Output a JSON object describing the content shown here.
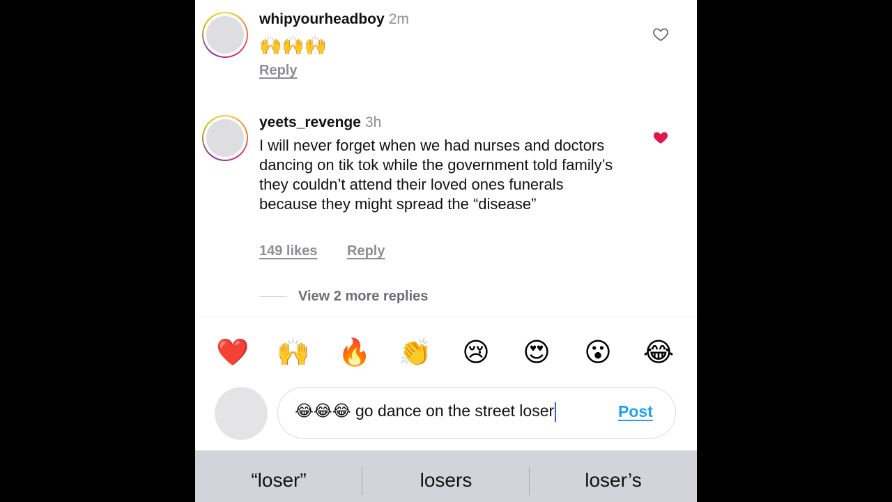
{
  "comments": [
    {
      "username": "whipyourheadboy",
      "time": "2m",
      "text": "🙌🙌🙌",
      "reply_label": "Reply",
      "liked": false,
      "heart_icon": "heart-outline-icon"
    },
    {
      "username": "yeets_revenge",
      "time": "3h",
      "text": "I will never forget when we had nurses and doctors dancing on tik tok while the government told family’s they couldn’t attend their loved ones funerals because they might spread the “disease”",
      "likes_label": "149 likes",
      "reply_label": "Reply",
      "liked": true,
      "heart_icon": "heart-filled-icon"
    }
  ],
  "view_more_label": "View 2 more replies",
  "quick_emojis": [
    "❤️",
    "🙌",
    "🔥",
    "👏",
    "😢",
    "😍",
    "😮",
    "😂"
  ],
  "composer": {
    "text": "😂😂😂 go dance on the street loser",
    "post_label": "Post"
  },
  "suggestions": [
    "“loser”",
    "losers",
    "loser’s"
  ],
  "colors": {
    "liked_heart": "#e0174d",
    "post_button": "#1fa1f1",
    "muted_text": "#8e8e93",
    "keyboard_bar": "#d2d4da"
  }
}
